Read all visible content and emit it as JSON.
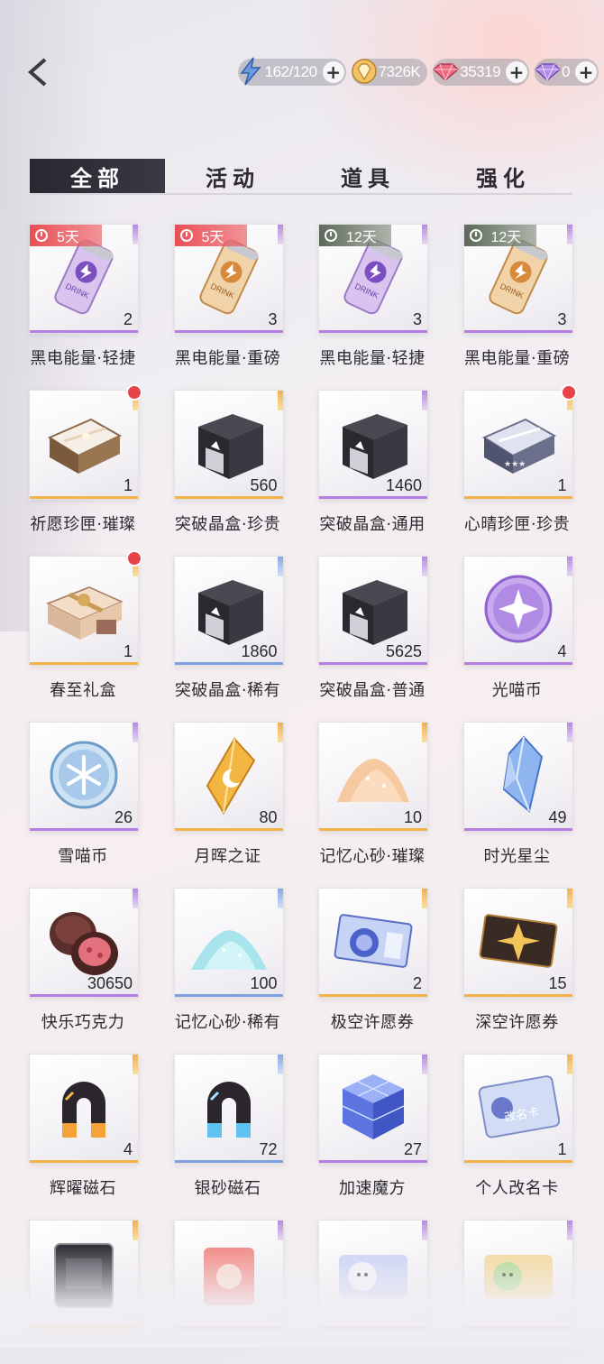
{
  "currencies": [
    {
      "icon": "lightning-stamina-icon",
      "amount": "162/120",
      "color": "#5f8fd8"
    },
    {
      "icon": "gold-diamond-icon",
      "amount": "7326K",
      "color": "#e0a94a"
    },
    {
      "icon": "red-gem-icon",
      "amount": "35319",
      "color": "#e2546b"
    },
    {
      "icon": "purple-gem-icon",
      "amount": "0",
      "color": "#a06ad8"
    }
  ],
  "tabs": [
    {
      "label": "全部",
      "active": true
    },
    {
      "label": "活动",
      "active": false
    },
    {
      "label": "道具",
      "active": false
    },
    {
      "label": "强化",
      "active": false
    }
  ],
  "items": [
    {
      "name": "黑电能量·轻捷",
      "qty": "2",
      "timer": "5天",
      "timer_color": "red",
      "rarity": "purple",
      "icon": "purple-drink-can-icon"
    },
    {
      "name": "黑电能量·重磅",
      "qty": "3",
      "timer": "5天",
      "timer_color": "red",
      "rarity": "purple",
      "icon": "gold-drink-can-icon"
    },
    {
      "name": "黑电能量·轻捷",
      "qty": "3",
      "timer": "12天",
      "timer_color": "green",
      "rarity": "purple",
      "icon": "purple-drink-can-icon"
    },
    {
      "name": "黑电能量·重磅",
      "qty": "3",
      "timer": "12天",
      "timer_color": "green",
      "rarity": "purple",
      "icon": "gold-drink-can-icon"
    },
    {
      "name": "祈愿珍匣·璀璨",
      "qty": "1",
      "rarity": "gold",
      "dot": true,
      "icon": "gold-gift-case-icon"
    },
    {
      "name": "突破晶盒·珍贵",
      "qty": "560",
      "rarity": "gold",
      "icon": "black-crystal-box-icon"
    },
    {
      "name": "突破晶盒·通用",
      "qty": "1460",
      "rarity": "purple",
      "icon": "black-crystal-box-icon"
    },
    {
      "name": "心晴珍匣·珍贵",
      "qty": "1",
      "rarity": "gold",
      "dot": true,
      "icon": "silver-gift-case-icon"
    },
    {
      "name": "春至礼盒",
      "qty": "1",
      "rarity": "gold",
      "dot": true,
      "icon": "ribbon-gift-box-icon"
    },
    {
      "name": "突破晶盒·稀有",
      "qty": "1860",
      "rarity": "blue",
      "icon": "black-crystal-box-icon"
    },
    {
      "name": "突破晶盒·普通",
      "qty": "5625",
      "rarity": "purple",
      "icon": "black-crystal-box-icon"
    },
    {
      "name": "光喵币",
      "qty": "4",
      "rarity": "purple",
      "icon": "purple-star-coin-icon"
    },
    {
      "name": "雪喵币",
      "qty": "26",
      "rarity": "purple",
      "icon": "blue-snow-coin-icon"
    },
    {
      "name": "月晖之证",
      "qty": "80",
      "rarity": "gold",
      "icon": "gold-moon-crystal-icon"
    },
    {
      "name": "记忆心砂·璀璨",
      "qty": "10",
      "rarity": "gold",
      "icon": "gold-sand-pile-icon"
    },
    {
      "name": "时光星尘",
      "qty": "49",
      "rarity": "purple",
      "icon": "blue-crystal-shard-icon"
    },
    {
      "name": "快乐巧克力",
      "qty": "30650",
      "rarity": "purple",
      "icon": "chocolate-icon"
    },
    {
      "name": "记忆心砂·稀有",
      "qty": "100",
      "rarity": "blue",
      "icon": "blue-sand-pile-icon"
    },
    {
      "name": "极空许愿券",
      "qty": "2",
      "rarity": "gold",
      "icon": "blue-wish-ticket-icon"
    },
    {
      "name": "深空许愿券",
      "qty": "15",
      "rarity": "gold",
      "icon": "gold-wish-ticket-icon"
    },
    {
      "name": "辉曜磁石",
      "qty": "4",
      "rarity": "gold",
      "icon": "gold-magnet-icon"
    },
    {
      "name": "银砂磁石",
      "qty": "72",
      "rarity": "blue",
      "icon": "blue-magnet-icon"
    },
    {
      "name": "加速魔方",
      "qty": "27",
      "rarity": "purple",
      "icon": "blue-cube-icon"
    },
    {
      "name": "个人改名卡",
      "qty": "1",
      "rarity": "gold",
      "icon": "rename-card-icon",
      "card_text": "改名卡"
    },
    {
      "name": "",
      "qty": "",
      "rarity": "gold",
      "icon": "dark-frame-icon"
    },
    {
      "name": "",
      "qty": "",
      "rarity": "purple",
      "icon": "red-envelope-icon"
    },
    {
      "name": "",
      "qty": "",
      "rarity": "purple",
      "icon": "cute-ticket-icon"
    },
    {
      "name": "",
      "qty": "",
      "rarity": "purple",
      "icon": "green-cute-ticket-icon"
    }
  ]
}
